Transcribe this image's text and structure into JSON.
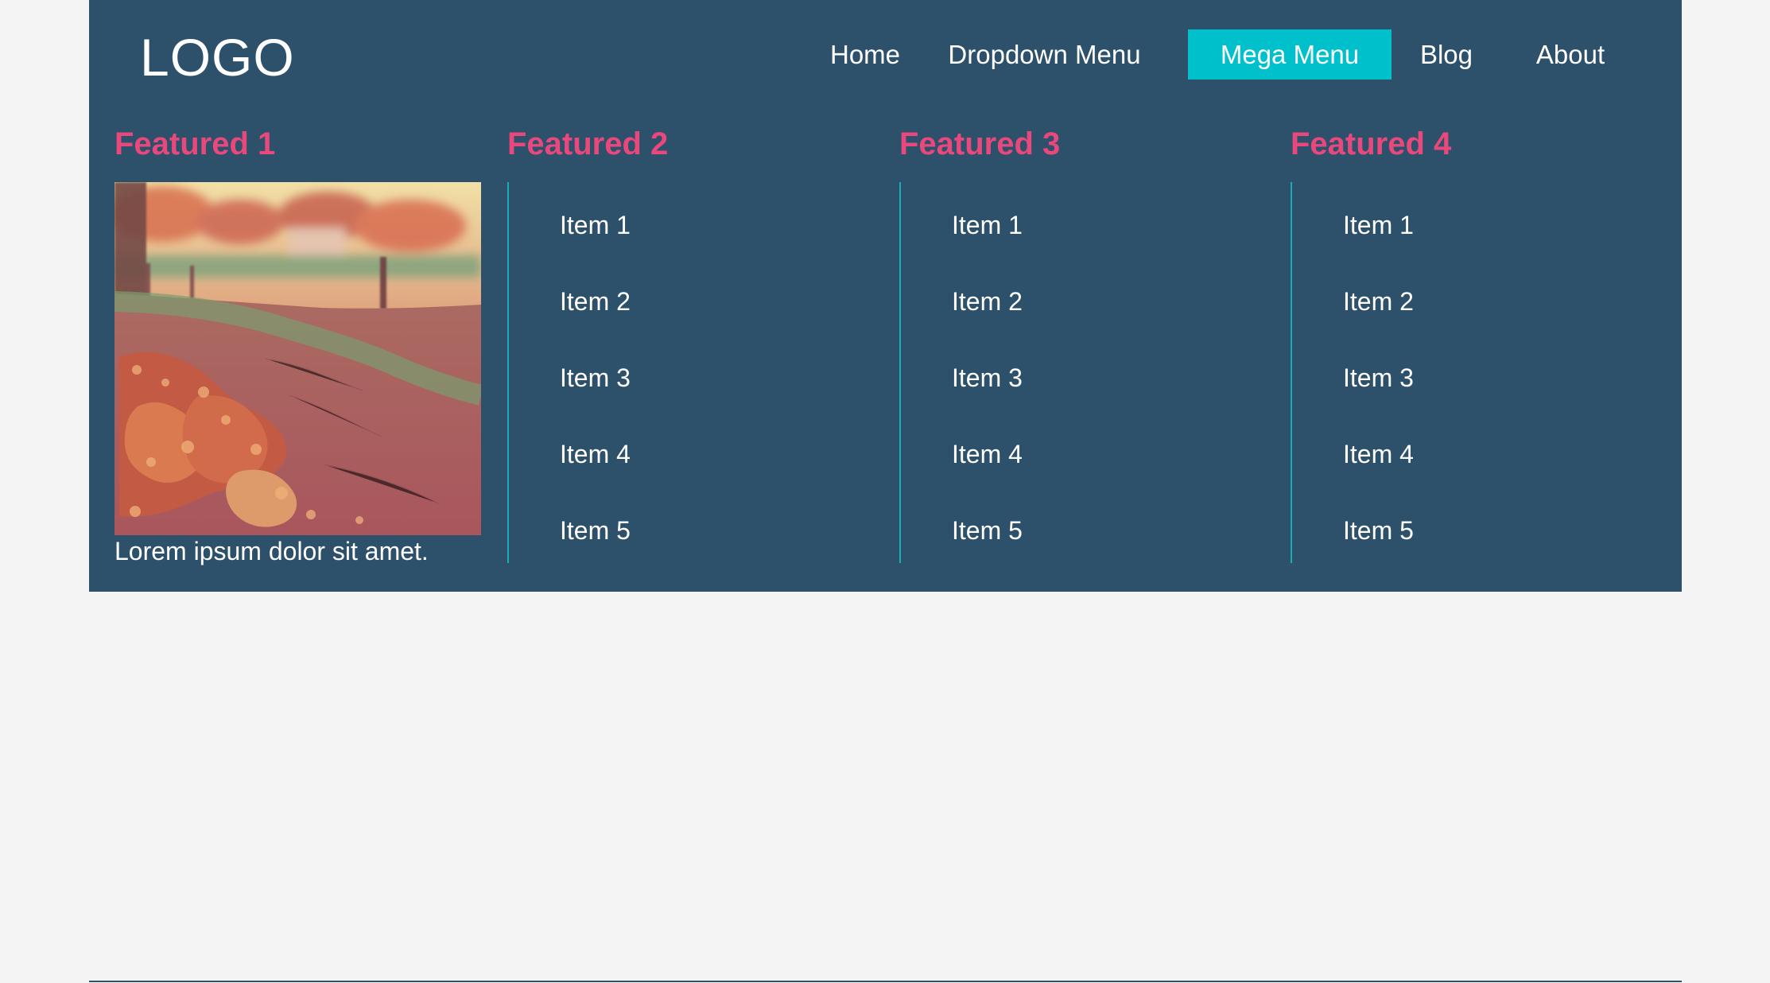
{
  "header": {
    "logo": "LOGO",
    "nav_items": [
      {
        "label": "Home",
        "active": false
      },
      {
        "label": "Dropdown Menu",
        "active": false
      },
      {
        "label": "Mega Menu",
        "active": true
      },
      {
        "label": "Blog",
        "active": false
      },
      {
        "label": "About",
        "active": false
      }
    ]
  },
  "mega_menu": {
    "columns": [
      {
        "title": "Featured 1",
        "image_alt": "autumn leaves path",
        "caption": "Lorem ipsum dolor sit amet."
      },
      {
        "title": "Featured 2",
        "items": [
          "Item 1",
          "Item 2",
          "Item 3",
          "Item 4",
          "Item 5"
        ]
      },
      {
        "title": "Featured 3",
        "items": [
          "Item 1",
          "Item 2",
          "Item 3",
          "Item 4",
          "Item 5"
        ]
      },
      {
        "title": "Featured 4",
        "items": [
          "Item 1",
          "Item 2",
          "Item 3",
          "Item 4",
          "Item 5"
        ]
      }
    ]
  },
  "colors": {
    "background": "#f4f4f4",
    "navbar": "#2d506b",
    "active_accent": "#00c0cb",
    "heading_accent": "#e8487b",
    "divider": "#16aeb7",
    "text": "#ffffff"
  }
}
